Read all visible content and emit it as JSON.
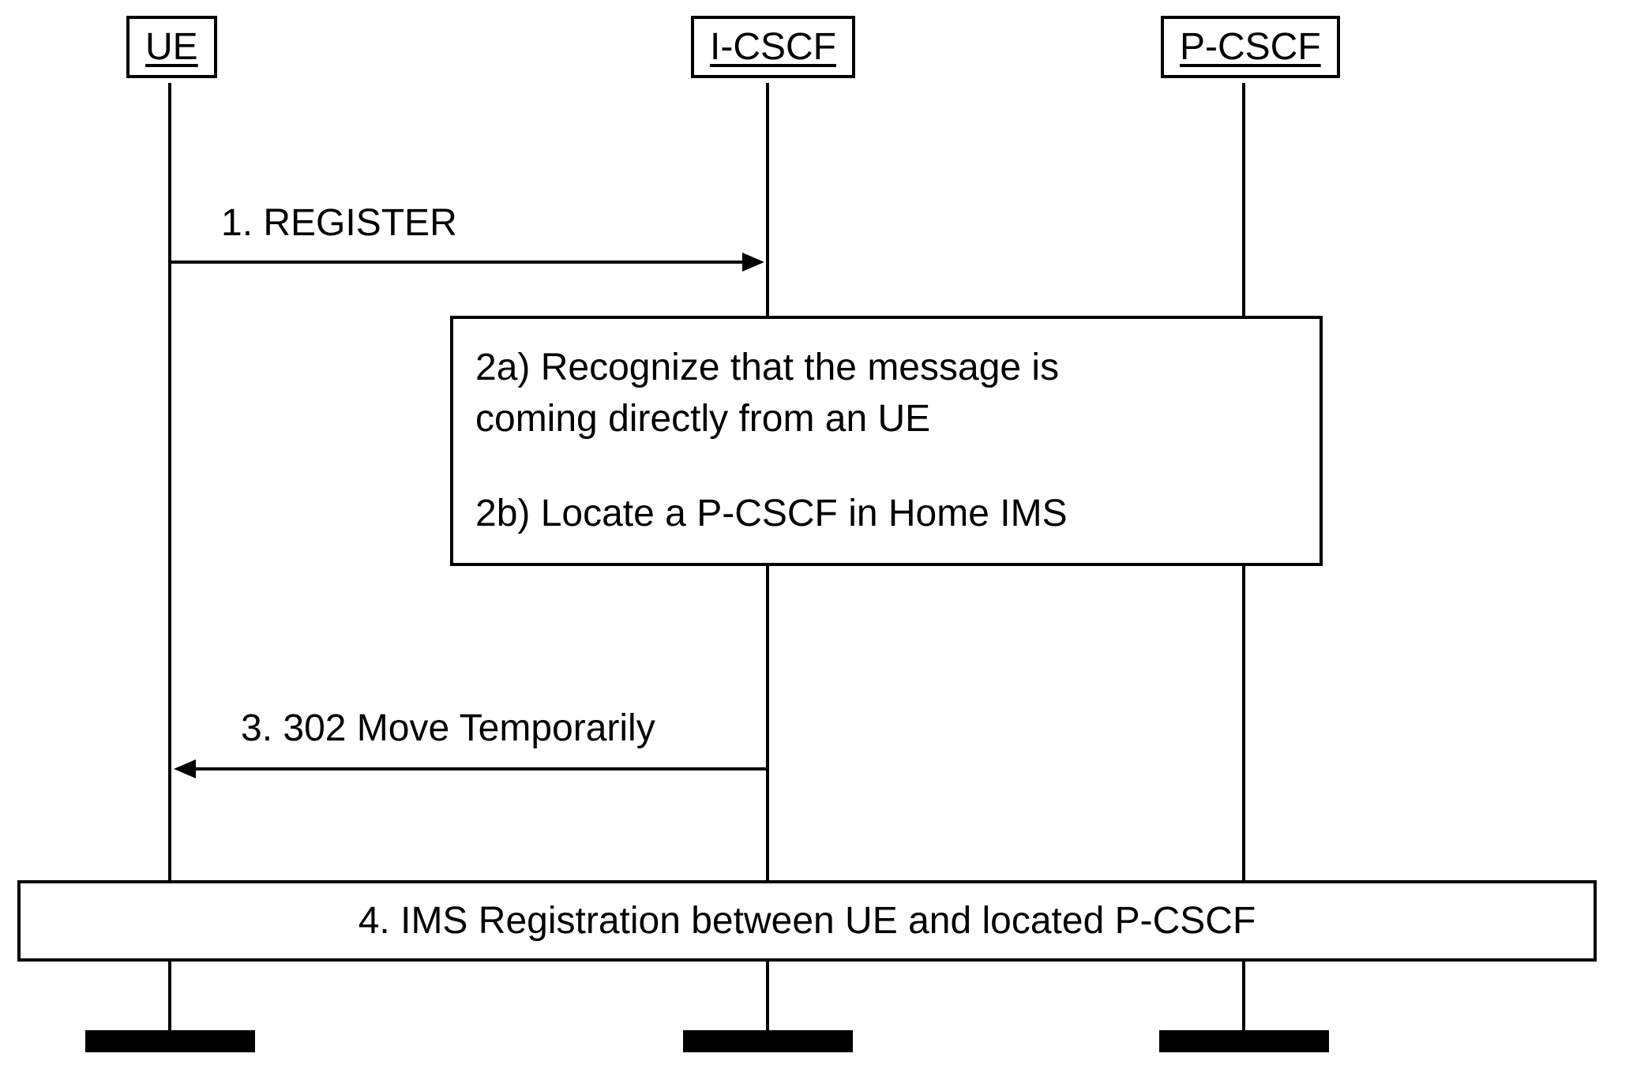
{
  "actors": {
    "ue": {
      "label": "UE"
    },
    "icscf": {
      "label": "I-CSCF"
    },
    "pcscf": {
      "label": "P-CSCF"
    }
  },
  "messages": {
    "step1": "1. REGISTER",
    "step3": "3. 302 Move Temporarily"
  },
  "note": {
    "line1": "2a) Recognize that the message is",
    "line2": "coming directly from an UE",
    "line3": "2b) Locate   a P-CSCF in Home IMS"
  },
  "step4": "4. IMS Registration between UE and located P-CSCF"
}
